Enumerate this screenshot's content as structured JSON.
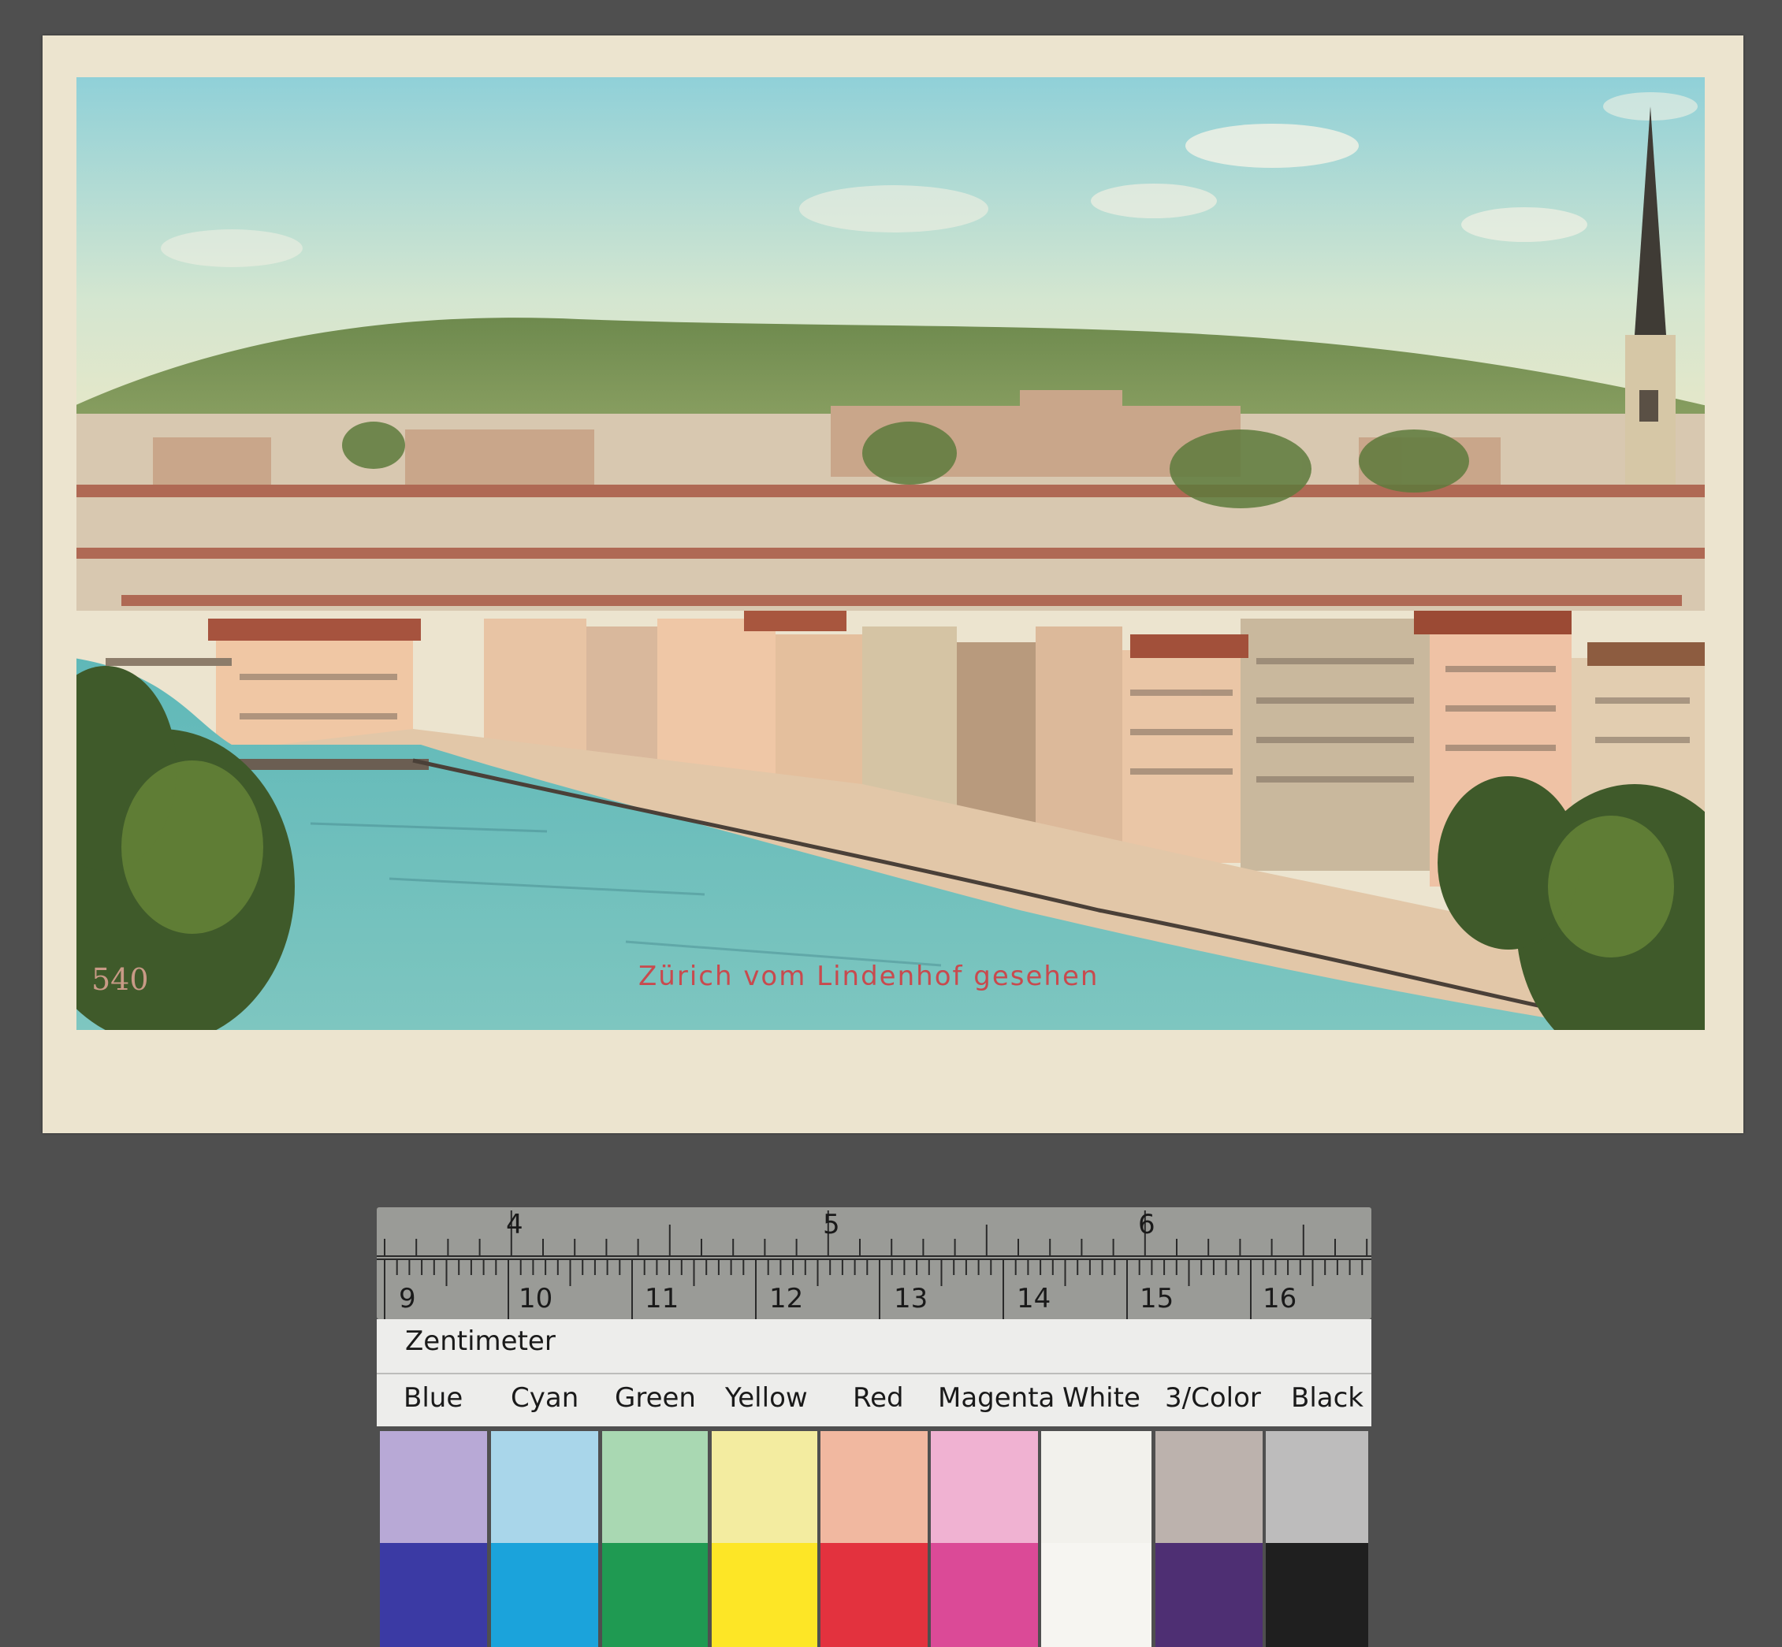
{
  "postcard": {
    "caption": "Zürich vom Lindenhof gesehen",
    "number": "540"
  },
  "ruler": {
    "inch_labels": [
      "4",
      "5",
      "6"
    ],
    "cm_labels": [
      "9",
      "10",
      "11",
      "12",
      "13",
      "14",
      "15",
      "16"
    ],
    "unit_label": "Zentimeter"
  },
  "color_target": {
    "labels": [
      "Blue",
      "Cyan",
      "Green",
      "Yellow",
      "Red",
      "Magenta",
      "White",
      "3/Color",
      "Black"
    ],
    "light_colors": [
      "#b8a9d6",
      "#a9d6ea",
      "#a9d8b2",
      "#f3eca0",
      "#f1b8a0",
      "#f0b2d2",
      "#f2f1ec",
      "#bcb2ad",
      "#bdbcbc"
    ],
    "dark_colors": [
      "#3b3aa4",
      "#1ba3db",
      "#1f9a52",
      "#fde626",
      "#e3323e",
      "#db4a97",
      "#f6f5f1",
      "#4e2f73",
      "#1f1f1f"
    ]
  }
}
